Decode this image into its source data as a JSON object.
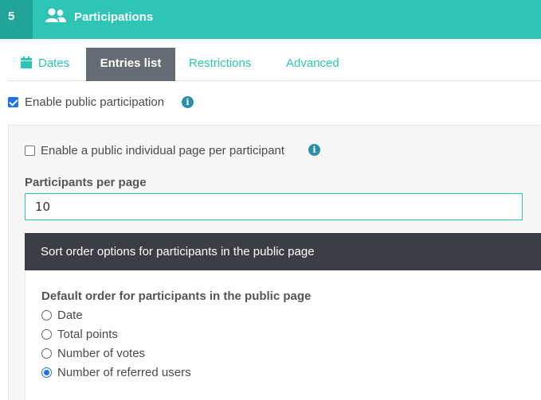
{
  "header": {
    "step_number": "5",
    "icon": "users-icon",
    "title": "Participations",
    "accent": "#2ec4b6"
  },
  "tabs": [
    {
      "label": "Dates",
      "icon": "calendar-icon",
      "active": false
    },
    {
      "label": "Entries list",
      "active": true
    },
    {
      "label": "Restrictions",
      "active": false
    },
    {
      "label": "Advanced",
      "active": false
    }
  ],
  "public_participation": {
    "label": "Enable public participation",
    "checked": true
  },
  "individual_page": {
    "label": "Enable a public individual page per participant",
    "checked": false
  },
  "participants_per_page": {
    "label": "Participants per page",
    "value": "10"
  },
  "sort_section": {
    "title": "Sort order options for participants in the public page",
    "default_order_label": "Default order for participants in the public page",
    "options": [
      {
        "label": "Date",
        "selected": false
      },
      {
        "label": "Total points",
        "selected": false
      },
      {
        "label": "Number of votes",
        "selected": false
      },
      {
        "label": "Number of referred users",
        "selected": true
      }
    ]
  }
}
